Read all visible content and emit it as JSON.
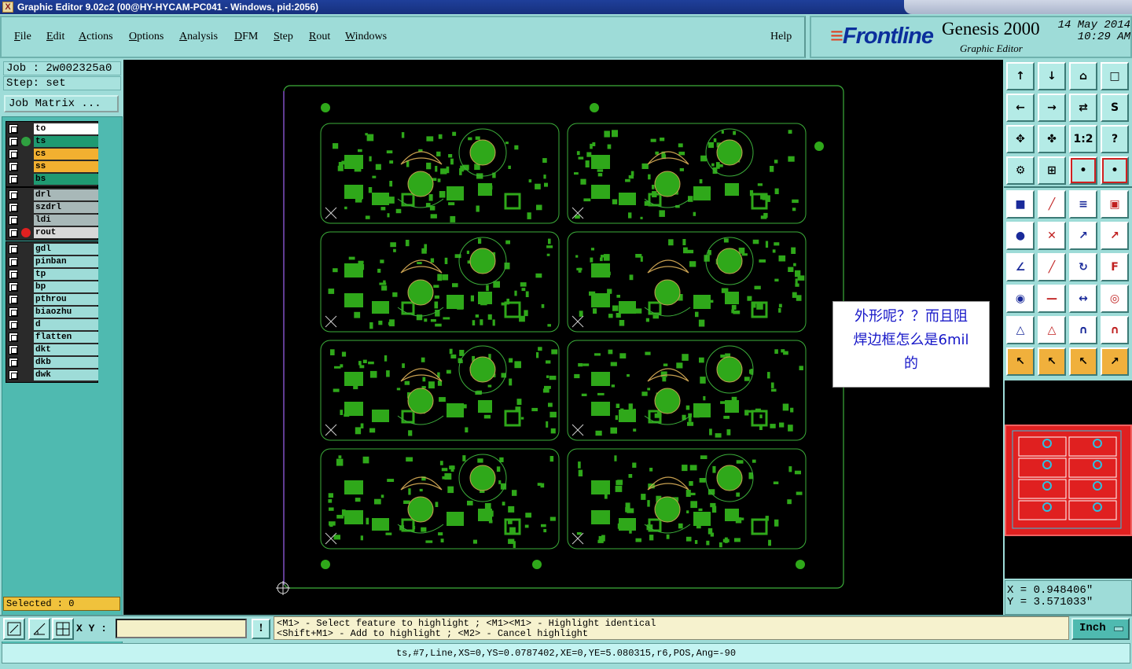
{
  "window": {
    "title": "Graphic Editor 9.02c2 (00@HY-HYCAM-PC041 - Windows, pid:2056)"
  },
  "menu": [
    {
      "label": "File",
      "u": "F",
      "rest": "ile"
    },
    {
      "label": "Edit",
      "u": "E",
      "rest": "dit"
    },
    {
      "label": "Actions",
      "u": "A",
      "rest": "ctions"
    },
    {
      "label": "Options",
      "u": "O",
      "rest": "ptions"
    },
    {
      "label": "Analysis",
      "u": "A",
      "rest": "nalysis"
    },
    {
      "label": "DFM",
      "u": "D",
      "rest": "FM"
    },
    {
      "label": "Step",
      "u": "S",
      "rest": "tep"
    },
    {
      "label": "Rout",
      "u": "R",
      "rest": "out"
    },
    {
      "label": "Windows",
      "u": "W",
      "rest": "indows"
    },
    {
      "label": "Help",
      "u": "",
      "rest": "Help"
    }
  ],
  "brand": {
    "logo": "Frontline",
    "logo_bars": "≡",
    "product": "Genesis 2000",
    "subtitle": "Graphic Editor",
    "date": "14 May 2014",
    "time": "10:29 AM"
  },
  "job": {
    "line": "Job : 2w002325a0",
    "step": "Step: set",
    "matrix_button": "Job Matrix ..."
  },
  "layers": {
    "board": [
      {
        "name": "to",
        "bg": "#ffffff",
        "dot": ""
      },
      {
        "name": "ts",
        "bg": "#1f9a72",
        "dot": "#2fa040"
      },
      {
        "name": "cs",
        "bg": "#f2b030",
        "dot": ""
      },
      {
        "name": "ss",
        "bg": "#f2b030",
        "dot": ""
      },
      {
        "name": "bs",
        "bg": "#1f9a72",
        "dot": ""
      }
    ],
    "drill": [
      {
        "name": "drl",
        "bg": "#a8b8b8",
        "dot": ""
      },
      {
        "name": "szdrl",
        "bg": "#a8b8b8",
        "dot": ""
      },
      {
        "name": "ldi",
        "bg": "#a8b8b8",
        "dot": ""
      },
      {
        "name": "rout",
        "bg": "#d8d8d8",
        "dot": "#e02020"
      }
    ],
    "misc": [
      {
        "name": "gdl",
        "bg": "#9edcd8",
        "dot": ""
      },
      {
        "name": "pinban",
        "bg": "#9edcd8",
        "dot": ""
      },
      {
        "name": "tp",
        "bg": "#9edcd8",
        "dot": ""
      },
      {
        "name": "bp",
        "bg": "#9edcd8",
        "dot": ""
      },
      {
        "name": "pthrou",
        "bg": "#9edcd8",
        "dot": ""
      },
      {
        "name": "biaozhu",
        "bg": "#9edcd8",
        "dot": ""
      },
      {
        "name": "d",
        "bg": "#9edcd8",
        "dot": ""
      },
      {
        "name": "flatten",
        "bg": "#9edcd8",
        "dot": ""
      },
      {
        "name": "dkt",
        "bg": "#9edcd8",
        "dot": ""
      },
      {
        "name": "dkb",
        "bg": "#9edcd8",
        "dot": ""
      },
      {
        "name": "dwk",
        "bg": "#9edcd8",
        "dot": ""
      }
    ]
  },
  "selected": "Selected : 0",
  "note": {
    "line1": "外形呢？？而且阻",
    "line2": "焊边框怎么是6mil",
    "line3": "的"
  },
  "coords": {
    "x": "X = 0.948406\"",
    "y": "Y = 3.571033\""
  },
  "bottom": {
    "xy_label": "X Y :",
    "xy_value": "",
    "hint_button": "!",
    "hint1": "<M1> - Select feature to highlight ; <M1><M1> - Highlight identical",
    "hint2": "<Shift+M1> - Add to highlight ; <M2> - Cancel highlight",
    "unit": "Inch"
  },
  "status": "ts,#7,Line,XS=0,YS=0.0787402,XE=0,YE=5.080315,r6,POS,Ang=-90",
  "colors": {
    "copper": "#2fa81a",
    "outline": "#3cae3a",
    "route": "#7d44c0",
    "highlight": "#c8a050"
  }
}
